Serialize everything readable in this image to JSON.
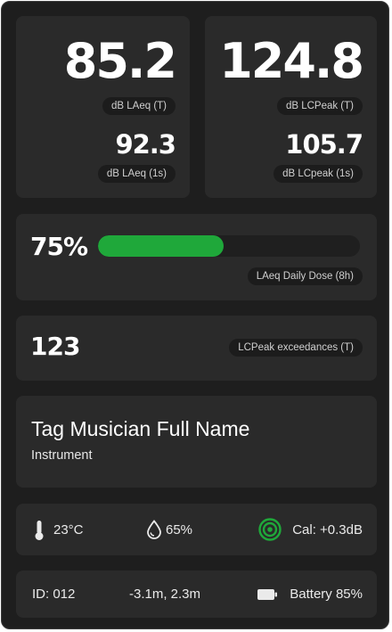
{
  "laeq_card": {
    "main_value": "85.2",
    "main_label": "dB LAeq (T)",
    "sub_value": "92.3",
    "sub_label": "dB LAeq (1s)"
  },
  "lcpeak_card": {
    "main_value": "124.8",
    "main_label": "dB LCPeak (T)",
    "sub_value": "105.7",
    "sub_label": "dB LCpeak (1s)"
  },
  "dose": {
    "percent_text": "75%",
    "fraction": 0.48,
    "label": "LAeq Daily Dose (8h)",
    "bar_color": "#1fa83a"
  },
  "exceedances": {
    "count": "123",
    "label": "LCPeak exceedances (T)"
  },
  "musician": {
    "name": "Tag Musician Full Name",
    "instrument": "Instrument"
  },
  "environment": {
    "temperature": "23°C",
    "humidity": "65%",
    "calibration": "Cal: +0.3dB",
    "icons": [
      "thermometer-icon",
      "droplet-icon",
      "target-icon"
    ],
    "cal_color": "#1fa83a"
  },
  "device": {
    "id": "ID: 012",
    "position": "-3.1m, 2.3m",
    "battery": "Battery 85%",
    "icons": [
      "battery-icon"
    ]
  }
}
